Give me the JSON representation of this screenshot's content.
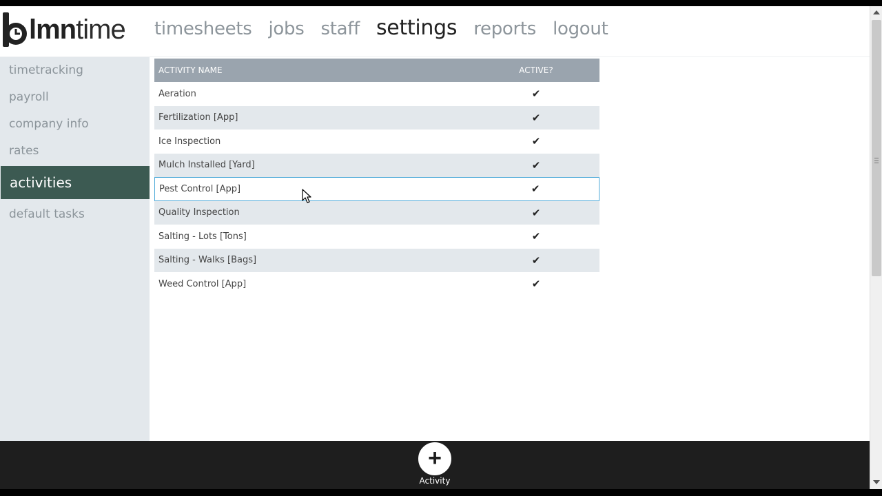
{
  "logo": {
    "part1": "lmn",
    "part2": "time"
  },
  "nav": {
    "items": [
      {
        "label": "timesheets"
      },
      {
        "label": "jobs"
      },
      {
        "label": "staff"
      },
      {
        "label": "settings"
      },
      {
        "label": "reports"
      },
      {
        "label": "logout"
      }
    ],
    "active": "settings"
  },
  "sidebar": {
    "items": [
      {
        "label": "timetracking"
      },
      {
        "label": "payroll"
      },
      {
        "label": "company info"
      },
      {
        "label": "rates"
      },
      {
        "label": "activities"
      },
      {
        "label": "default tasks"
      }
    ],
    "active": "activities"
  },
  "table": {
    "headers": {
      "name": "ACTIVITY NAME",
      "active": "ACTIVE?"
    },
    "rows": [
      {
        "name": "Aeration",
        "active": "✔"
      },
      {
        "name": "Fertilization [App]",
        "active": "✔"
      },
      {
        "name": "Ice Inspection",
        "active": "✔"
      },
      {
        "name": "Mulch Installed [Yard]",
        "active": "✔"
      },
      {
        "name": "Pest Control [App]",
        "active": "✔"
      },
      {
        "name": "Quality Inspection",
        "active": "✔"
      },
      {
        "name": "Salting - Lots [Tons]",
        "active": "✔"
      },
      {
        "name": "Salting - Walks [Bags]",
        "active": "✔"
      },
      {
        "name": "Weed Control [App]",
        "active": "✔"
      }
    ]
  },
  "bottom": {
    "add_label": "Activity",
    "add_icon": "plus-circle-icon"
  },
  "colors": {
    "sidebar_active": "#3c5a52",
    "header_bg": "#9aa4ae",
    "row_alt": "#e3e8ec",
    "hover_border": "#4aa8d8"
  }
}
